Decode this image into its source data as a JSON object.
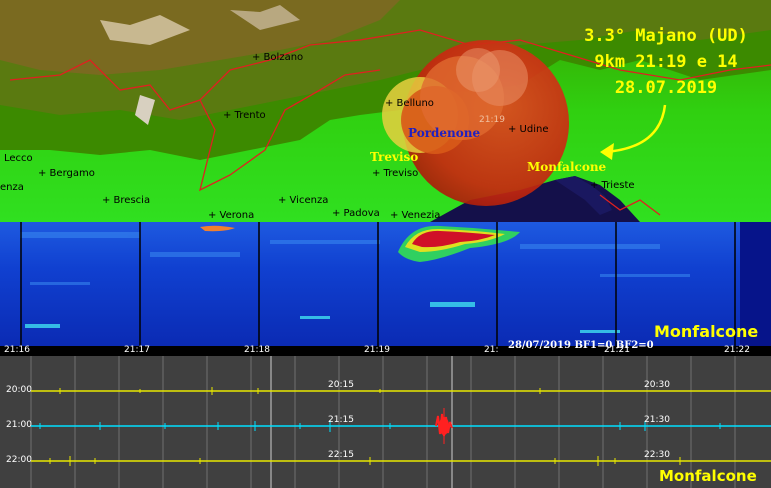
{
  "map": {
    "cities": [
      {
        "id": "bolzano",
        "label": "+ Bolzano"
      },
      {
        "id": "trento",
        "label": "+ Trento"
      },
      {
        "id": "belluno",
        "label": "+ Belluno"
      },
      {
        "id": "lecco",
        "label": "Lecco"
      },
      {
        "id": "bergamo",
        "label": "+ Bergamo"
      },
      {
        "id": "brescia",
        "label": "+ Brescia"
      },
      {
        "id": "vicenza",
        "label": "+ Vicenza"
      },
      {
        "id": "verona",
        "label": "+ Verona"
      },
      {
        "id": "padova",
        "label": "+ Padova"
      },
      {
        "id": "venezia",
        "label": "+ Venezia"
      },
      {
        "id": "treviso",
        "label": "+ Treviso"
      },
      {
        "id": "udine",
        "label": "+ Udine"
      },
      {
        "id": "trieste",
        "label": "+ Trieste"
      },
      {
        "id": "enza",
        "label": "enza"
      }
    ],
    "stations": {
      "pordenone": "Pordenone",
      "treviso": "Treviso",
      "monfalcone": "Monfalcone"
    },
    "event_time_marker": "21:19",
    "quake": {
      "line1": "3.3° Majano (UD)",
      "line2": "9km 21:19 e 14",
      "line3": "28.07.2019"
    },
    "colors": {
      "quake_text": "#ffff00",
      "arrow": "#ffff00",
      "pordenone": "#2020c0",
      "treviso": "#ffff00",
      "monfalcone": "#ffff00",
      "epicenter": "#d23010",
      "border": "#e02020"
    }
  },
  "spectrogram": {
    "station": "Monfalcone",
    "info": "28/07/2019 BF1=0 BF2=0",
    "time_labels": [
      "21:16",
      "21:17",
      "21:18",
      "21:19",
      "21:",
      "21:21",
      "21:22"
    ]
  },
  "seismogram": {
    "station": "Monfalcone",
    "traces": [
      {
        "start": "20:00",
        "mid": "20:15",
        "end": "20:30",
        "color": "#e8e800"
      },
      {
        "start": "21:00",
        "mid": "21:15",
        "end": "21:30",
        "color": "#00e0ff"
      },
      {
        "start": "22:00",
        "mid": "22:15",
        "end": "22:30",
        "color": "#e8e800"
      }
    ],
    "event_color": "#ff2020"
  }
}
